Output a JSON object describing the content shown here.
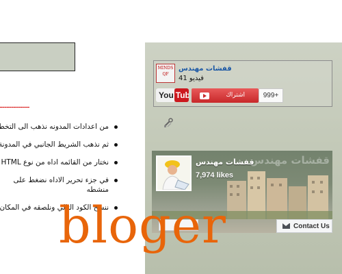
{
  "article": {
    "separator": "--------------",
    "steps": [
      "من اعدادات المدونه نذهب الى التخطيط",
      "ثم نذهب الشريط الجانبي في المدونة",
      "نختار من القائمه اداه من نوع HTML",
      "في جزء تحرير الاداه نضغط على منشطه",
      "ننسخ الكود التالي ونلصقه في المكان"
    ]
  },
  "youtube_widget": {
    "channel_name": "قفشات مهندس",
    "video_count": "41 فيديو",
    "logo_you": "You",
    "logo_tube": "Tube",
    "subscribe_label": "اشتراك",
    "subscriber_count": "999+",
    "thumb_text": "MINDS QF"
  },
  "facebook_widget": {
    "cover_title": "قفشات مهندس",
    "page_name": "قفشات مهندس",
    "likes": "7,974 likes",
    "contact_label": "Contact Us"
  },
  "watermark": "bloger",
  "colors": {
    "watermark": "#e8650a",
    "youtube_red": "#cc181e",
    "channel_link": "#1a57a5",
    "separator": "#d40000"
  }
}
